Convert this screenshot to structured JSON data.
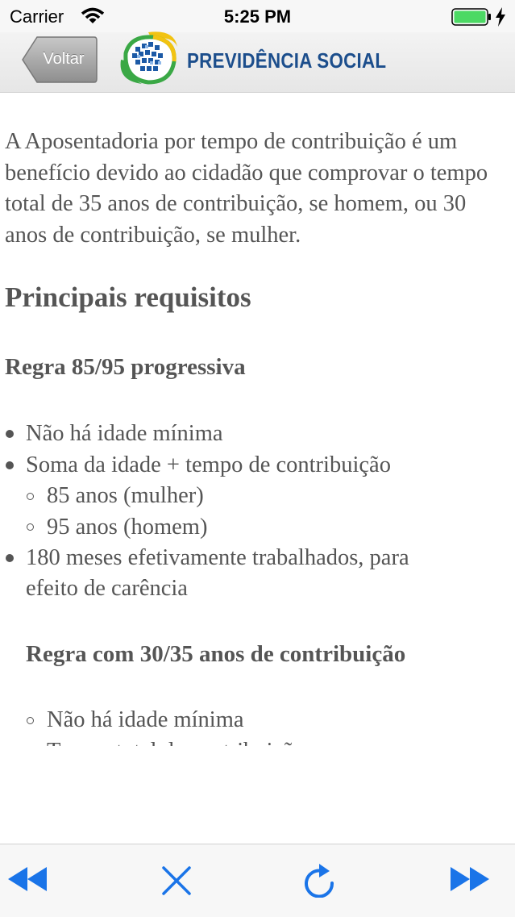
{
  "status_bar": {
    "carrier": "Carrier",
    "time": "5:25 PM"
  },
  "navbar": {
    "back_label": "Voltar",
    "logo_text": "PREVIDÊNCIA SOCIAL"
  },
  "content": {
    "intro": "A Aposentadoria por tempo de contribuição é um benefício devido ao cidadão que comprovar o tempo total de 35 anos de contribuição, se homem, ou 30 anos de contribuição, se mulher.",
    "heading": "Principais requisitos",
    "rule1_title": "Regra 85/95 progressiva",
    "rule1_items": [
      "Não há idade mínima",
      "Soma da idade + tempo de contribuição",
      "85 anos (mulher)",
      "95 anos (homem)",
      "180 meses efetivamente trabalhados, para",
      "efeito de carência"
    ],
    "rule2_title": "Regra com 30/35 anos de contribuição",
    "rule2_items": [
      "Não há idade mínima",
      "Tempo total de contribuição"
    ]
  },
  "toolbar": {
    "accent": "#1a74e8",
    "icons": [
      "rewind-icon",
      "close-icon",
      "refresh-icon",
      "fast-forward-icon"
    ]
  }
}
